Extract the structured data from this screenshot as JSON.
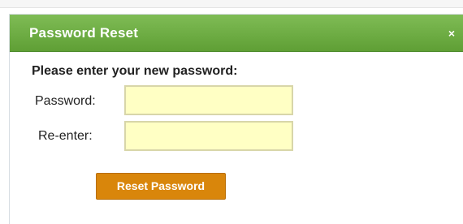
{
  "dialog": {
    "title": "Password Reset",
    "close_glyph": "×",
    "close_icon": "close-icon"
  },
  "form": {
    "prompt": "Please enter your new password:",
    "password_label": "Password:",
    "password_value": "",
    "reenter_label": "Re-enter:",
    "reenter_value": "",
    "submit_label": "Reset Password"
  },
  "colors": {
    "titlebar": "#6aab3f",
    "input_background": "#ffffc4",
    "button": "#d9860b"
  }
}
